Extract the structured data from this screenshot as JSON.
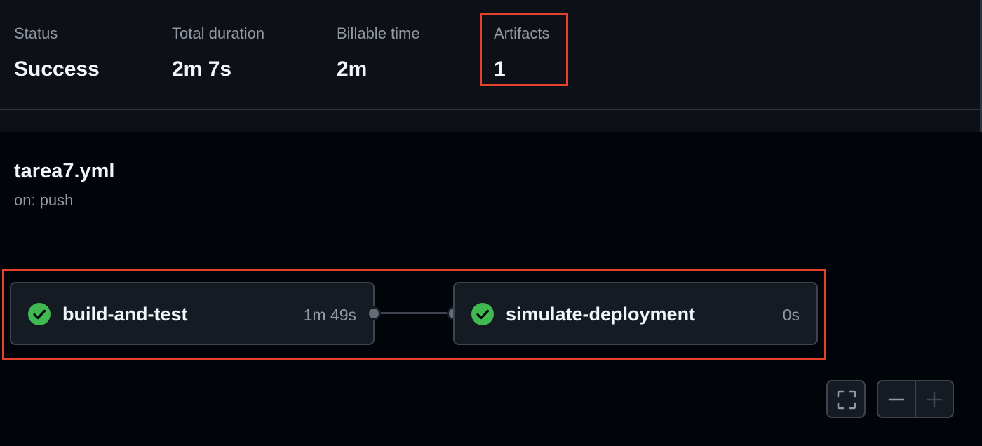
{
  "summary": {
    "status_label": "Status",
    "status_value": "Success",
    "duration_label": "Total duration",
    "duration_value": "2m 7s",
    "billable_label": "Billable time",
    "billable_value": "2m",
    "artifacts_label": "Artifacts",
    "artifacts_value": "1"
  },
  "workflow": {
    "name": "tarea7.yml",
    "trigger": "on: push"
  },
  "jobs": [
    {
      "name": "build-and-test",
      "duration": "1m 49s",
      "status": "success"
    },
    {
      "name": "simulate-deployment",
      "duration": "0s",
      "status": "success"
    }
  ],
  "controls": {
    "fullscreen_icon": "fullscreen-icon",
    "zoom_out_icon": "minus-icon",
    "zoom_in_icon": "plus-icon"
  },
  "colors": {
    "success": "#3fb950",
    "highlight": "#e5412d",
    "background": "#010409",
    "panel": "#0d1117"
  }
}
